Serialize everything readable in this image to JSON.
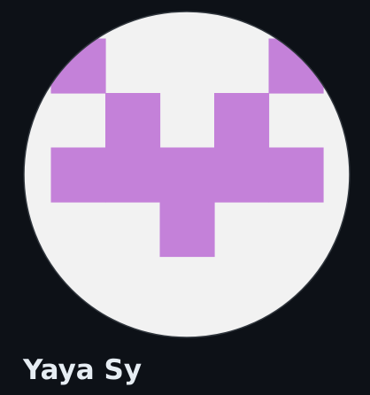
{
  "profile": {
    "display_name": "Yaya Sy",
    "avatar": {
      "icon": "identicon-avatar",
      "background_color": "#f2f2f2",
      "foreground_color": "#c481d9",
      "border_color": "#30363d",
      "grid": [
        [
          1,
          0,
          0,
          0,
          1
        ],
        [
          0,
          1,
          0,
          1,
          0
        ],
        [
          1,
          1,
          1,
          1,
          1
        ],
        [
          0,
          0,
          1,
          0,
          0
        ],
        [
          0,
          0,
          0,
          0,
          0
        ]
      ]
    }
  }
}
